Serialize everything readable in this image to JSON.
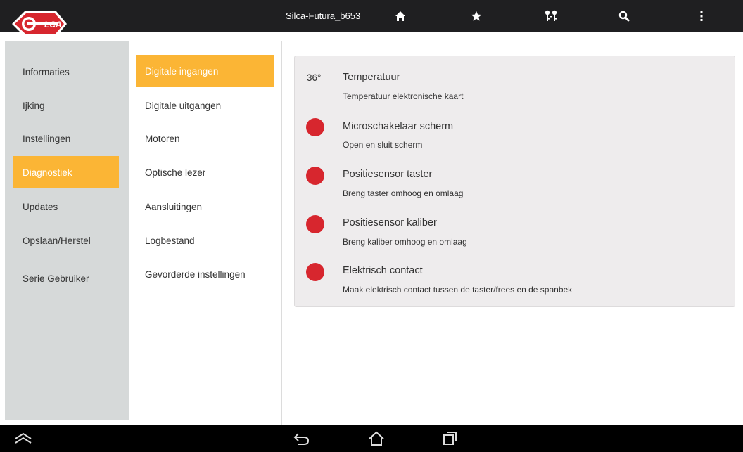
{
  "topbar": {
    "title": "Silca-Futura_b653",
    "icons": [
      "home-icon",
      "star-icon",
      "keys-icon",
      "search-icon",
      "more-vert-icon"
    ],
    "logo_text": "SILCA"
  },
  "sidebar": {
    "items": [
      {
        "label": "Informaties",
        "active": false
      },
      {
        "label": "Ijking",
        "active": false
      },
      {
        "label": "Instellingen",
        "active": false
      },
      {
        "label": "Diagnostiek",
        "active": true
      },
      {
        "label": "Updates",
        "active": false
      },
      {
        "label": "Opslaan/Herstel",
        "active": false
      },
      {
        "label": "Serie Gebruiker",
        "active": false
      }
    ]
  },
  "submenu": {
    "items": [
      {
        "label": "Digitale ingangen",
        "active": true
      },
      {
        "label": "Digitale uitgangen",
        "active": false
      },
      {
        "label": "Motoren",
        "active": false
      },
      {
        "label": "Optische lezer",
        "active": false
      },
      {
        "label": "Aansluitingen",
        "active": false
      },
      {
        "label": "Logbestand",
        "active": false
      },
      {
        "label": "Gevorderde instellingen",
        "active": false
      }
    ]
  },
  "panel": {
    "rows": [
      {
        "value": "36°",
        "title": "Temperatuur",
        "subtitle": "Temperatuur elektronische kaart"
      },
      {
        "title": "Microschakelaar scherm",
        "subtitle": "Open en sluit scherm"
      },
      {
        "title": "Positiesensor taster",
        "subtitle": "Breng taster omhoog en omlaag"
      },
      {
        "title": "Positiesensor kaliber",
        "subtitle": "Breng kaliber omhoog en omlaag"
      },
      {
        "title": "Elektrisch contact",
        "subtitle": "Maak elektrisch contact tussen de taster/frees en de spanbek"
      }
    ]
  },
  "navbar": {
    "icons": [
      "collapse-icon",
      "back-icon",
      "home-outline-icon",
      "recent-apps-icon"
    ]
  },
  "colors": {
    "accent": "#fbb535",
    "indicator_red": "#d7262e",
    "topbar": "#1f1f21",
    "sidebar_bg": "#d6d9d9",
    "panel_bg": "#eeeced"
  }
}
